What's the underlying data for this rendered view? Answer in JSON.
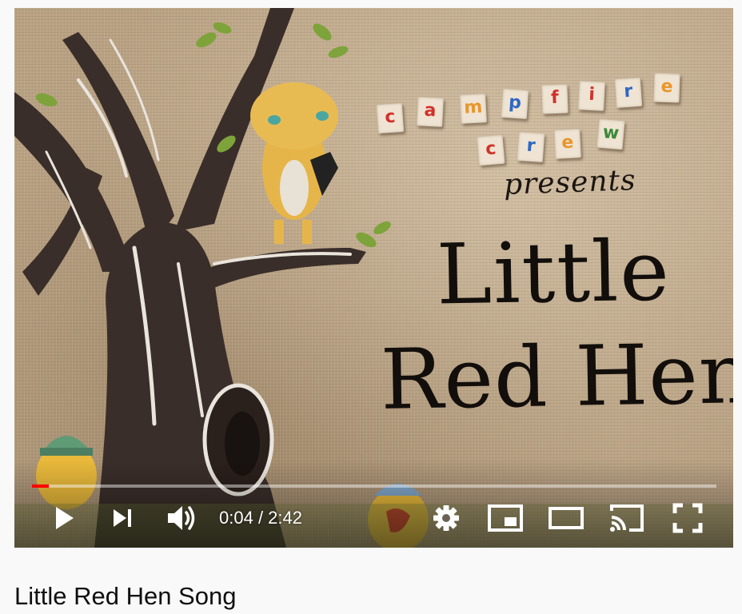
{
  "video": {
    "title_card": {
      "tiles_row1": [
        "c",
        "a",
        "m",
        "p",
        "f",
        "i",
        "r",
        "e"
      ],
      "tiles_row2": [
        "c",
        "r",
        "e",
        "w"
      ],
      "tile_colors_row1": [
        "#d2312a",
        "#d2312a",
        "#e8962b",
        "#2f67c4",
        "#d2312a",
        "#d2312a",
        "#2f67c4",
        "#e8962b"
      ],
      "tile_colors_row2": [
        "#d2312a",
        "#2f67c4",
        "#e8962b",
        "#3b8a3a"
      ],
      "presents": "presents",
      "line1": "Little",
      "line2": "Red Hen"
    },
    "controls": {
      "current_time": "0:04",
      "separator": " / ",
      "duration": "2:42",
      "progress_fraction": 0.025,
      "icons": [
        "play-icon",
        "next-icon",
        "volume-icon",
        "settings-icon",
        "miniplayer-icon",
        "theater-mode-icon",
        "cast-icon",
        "fullscreen-icon"
      ]
    },
    "colors": {
      "progress_played": "#ff0000",
      "tree": "#3a2e2a"
    }
  },
  "page": {
    "video_title": "Little Red Hen Song"
  }
}
